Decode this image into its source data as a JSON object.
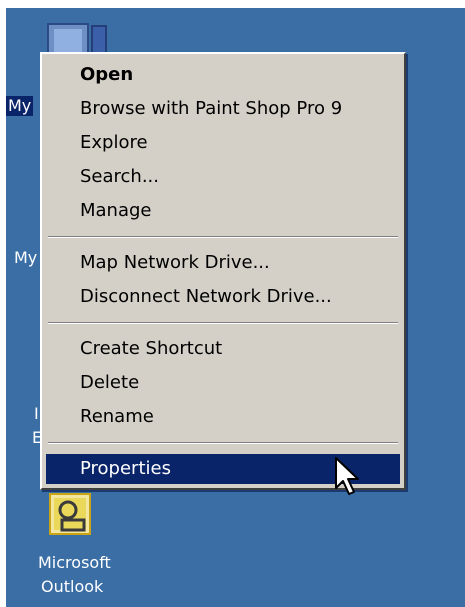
{
  "desktop": {
    "icons": [
      {
        "label": "My"
      },
      {
        "label": "My"
      },
      {
        "label": "I"
      },
      {
        "label": "E"
      },
      {
        "label_line1": "Microsoft",
        "label_line2": "Outlook"
      }
    ]
  },
  "context_menu": {
    "items": [
      {
        "label": "Open"
      },
      {
        "label": "Browse with Paint Shop Pro 9"
      },
      {
        "label": "Explore"
      },
      {
        "label": "Search..."
      },
      {
        "label": "Manage"
      },
      {
        "label": "Map Network Drive..."
      },
      {
        "label": "Disconnect Network Drive..."
      },
      {
        "label": "Create Shortcut"
      },
      {
        "label": "Delete"
      },
      {
        "label": "Rename"
      },
      {
        "label": "Properties"
      }
    ]
  },
  "colors": {
    "desktop_background": "#3a6ea5",
    "menu_background": "#d4d0c8",
    "highlight": "#0a246a"
  },
  "icon_names": [
    "my-computer-icon",
    "microsoft-outlook-icon",
    "arrow-cursor-icon"
  ]
}
